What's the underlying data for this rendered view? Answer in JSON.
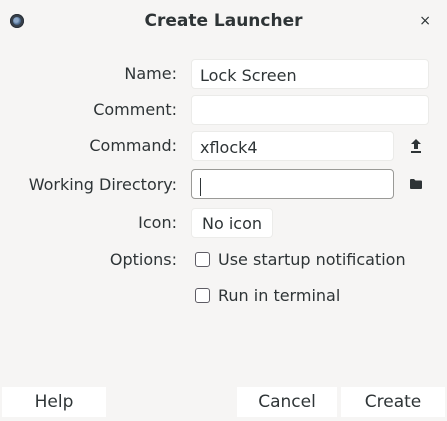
{
  "window": {
    "title": "Create Launcher",
    "close_glyph": "×"
  },
  "form": {
    "name_label": "Name:",
    "name_value": "Lock Screen",
    "comment_label": "Comment:",
    "comment_value": "",
    "command_label": "Command:",
    "command_value": "xflock4",
    "workdir_label": "Working Directory:",
    "workdir_value": "",
    "icon_label": "Icon:",
    "icon_button": "No icon",
    "options_label": "Options:",
    "startup_notification": "Use startup notification",
    "run_in_terminal": "Run in terminal"
  },
  "icons": {
    "command_action": "upload-icon",
    "workdir_action": "folder-icon"
  },
  "footer": {
    "help": "Help",
    "cancel": "Cancel",
    "create": "Create"
  }
}
